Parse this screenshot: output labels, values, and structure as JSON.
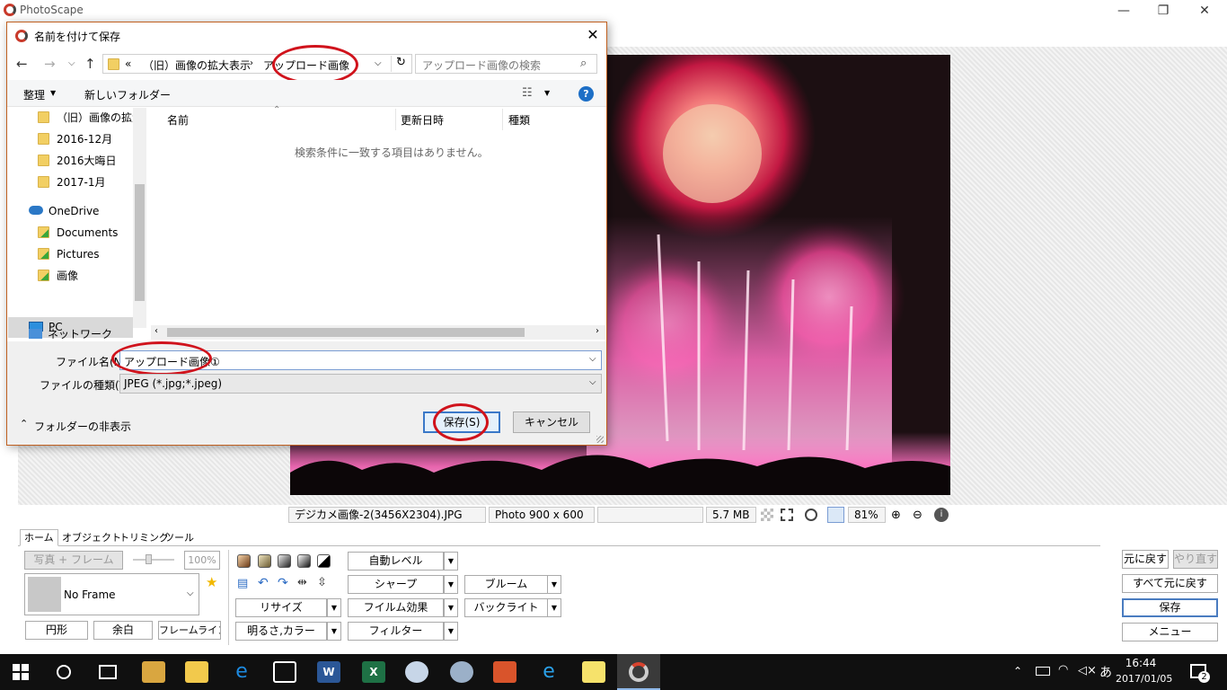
{
  "app": {
    "title": "PhotoScape",
    "minimize": "—",
    "maximize": "❐",
    "close": "✕"
  },
  "status": {
    "filename": "デジカメ画像-2(3456X2304).JPG",
    "dimensions": "Photo 900 x 600",
    "filesize": "5.7 MB",
    "zoom": "81%"
  },
  "tabs": [
    "ホーム",
    "オブジェクト",
    "トリミング",
    "ツール"
  ],
  "left_panel": {
    "photo_frame": "写真 + フレーム",
    "frame_percent": "100%",
    "frame_select": "No Frame",
    "circle": "円形",
    "margin": "余白",
    "frame_line": "フレームライン"
  },
  "tools": {
    "resize": "リサイズ",
    "brightness_color": "明るさ,カラー",
    "auto_level": "自動レベル",
    "sharp": "シャープ",
    "film_effect": "フイルム効果",
    "filter": "フィルター",
    "bloom": "ブルーム",
    "backlight": "バックライト"
  },
  "right_panel": {
    "undo": "元に戻す",
    "redo": "やり直す",
    "undo_all": "すべて元に戻す",
    "save": "保存",
    "menu": "メニュー"
  },
  "taskbar": {
    "time": "16:44",
    "date": "2017/01/05",
    "notifications": "2",
    "ime": "あ"
  },
  "dialog": {
    "title": "名前を付けて保存",
    "breadcrumb_prefix": "«",
    "breadcrumb_parent": "（旧）画像の拡大表示",
    "breadcrumb_current": "アップロード画像",
    "search_placeholder": "アップロード画像の検索",
    "organize": "整理",
    "new_folder": "新しいフォルダー",
    "tree": {
      "folders": [
        "（旧）画像の拡大",
        "2016-12月",
        "2016大晦日",
        "2017-1月"
      ],
      "onedrive": "OneDrive",
      "onedrive_items": [
        "Documents",
        "Pictures",
        "画像"
      ],
      "pc": "PC",
      "network": "ネットワーク"
    },
    "columns": [
      "名前",
      "更新日時",
      "種類"
    ],
    "empty_message": "検索条件に一致する項目はありません。",
    "filename_label": "ファイル名(N):",
    "filename_value": "アップロード画像①",
    "filetype_label": "ファイルの種類(T):",
    "filetype_value": "JPEG (*.jpg;*.jpeg)",
    "hide_folders": "フォルダーの非表示",
    "save_button": "保存(S)",
    "cancel_button": "キャンセル"
  },
  "colors": {
    "annotation_circle": "#d0131c",
    "dialog_border": "#c06020",
    "taskbar": "#101010",
    "selected_tree": "#cce0f7"
  }
}
